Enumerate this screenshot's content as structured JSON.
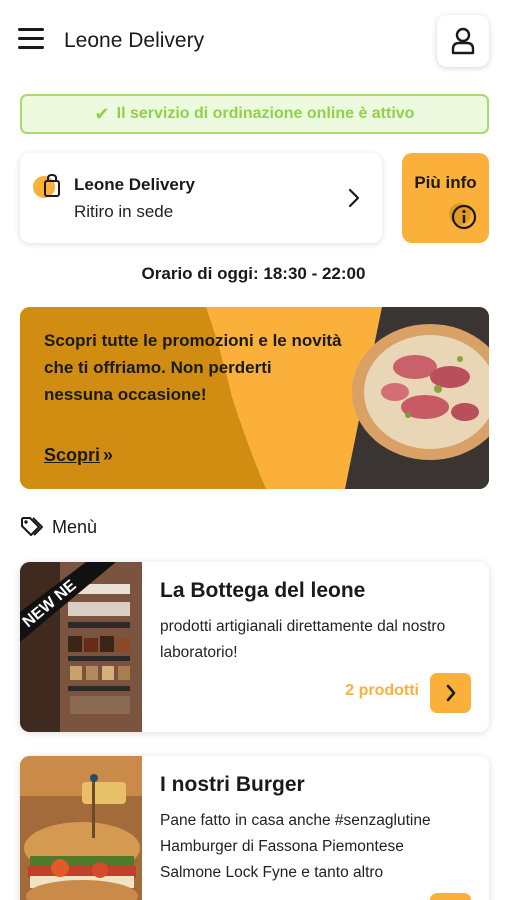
{
  "header": {
    "title": "Leone Delivery",
    "menu_icon": "hamburger-icon",
    "account_icon": "user-icon"
  },
  "status": {
    "text": "Il servizio di ordinazione online è attivo",
    "icon": "check-icon",
    "color": "#8fd24a"
  },
  "store": {
    "name": "Leone Delivery",
    "mode": "Ritiro in sede",
    "icon": "shopping-bag-icon"
  },
  "info_button": {
    "label": "Più info",
    "icon": "info-icon"
  },
  "hours": {
    "text": "Orario di oggi: 18:30 - 22:00"
  },
  "promo": {
    "text": "Scopri tutte le promozioni e le novità che ti offriamo. Non perderti nessuna occasione!",
    "link_label": "Scopri",
    "link_icon": "double-chevron-right-icon"
  },
  "menu": {
    "heading": "Menù",
    "heading_icon": "tags-icon",
    "items": [
      {
        "title": "La Bottega del leone",
        "description": "prodotti artigianali direttamente dal nostro laboratorio!",
        "count_label": "2 prodotti",
        "badge": "NEW NE"
      },
      {
        "title": "I nostri Burger",
        "description": "Pane fatto in casa anche #senzaglutine\nHamburger di Fassona Piemontese\nSalmone Lock Fyne e tanto altro",
        "count_label": ""
      }
    ]
  },
  "colors": {
    "accent": "#fbb03b",
    "accent_dark": "#d08d12",
    "success": "#8fd24a"
  }
}
